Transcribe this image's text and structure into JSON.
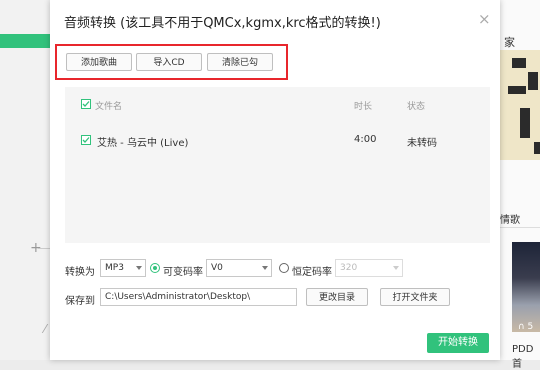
{
  "background": {
    "right_header_text": "家",
    "right_section_text": "情歌",
    "right_album_count": "∩ 5",
    "right_caption": "PDD首"
  },
  "dialog": {
    "title": "音频转换 (该工具不用于QMCx,kgmx,krc格式的转换!)",
    "close_symbol": "×"
  },
  "toolbar": {
    "add_song": "添加歌曲",
    "import_cd": "导入CD",
    "clear_checked": "清除已勾"
  },
  "song_list": {
    "columns": [
      "文件名",
      "时长",
      "状态"
    ],
    "rows": [
      {
        "name": "艾热 - 乌云中 (Live)",
        "duration": "4:00",
        "status": "未转码",
        "checked": true
      }
    ]
  },
  "convert": {
    "label": "转换为",
    "format_value": "MP3",
    "vbr_label": "可变码率",
    "vbr_value": "V0",
    "cbr_label": "恒定码率",
    "cbr_value": "320",
    "selected_mode": "vbr"
  },
  "save": {
    "label": "保存到",
    "path": "C:\\Users\\Administrator\\Desktop\\",
    "change_dir": "更改目录",
    "open_folder": "打开文件夹"
  },
  "start_button": "开始转换",
  "colors": {
    "accent": "#31c27c",
    "highlight": "#e8262c"
  }
}
